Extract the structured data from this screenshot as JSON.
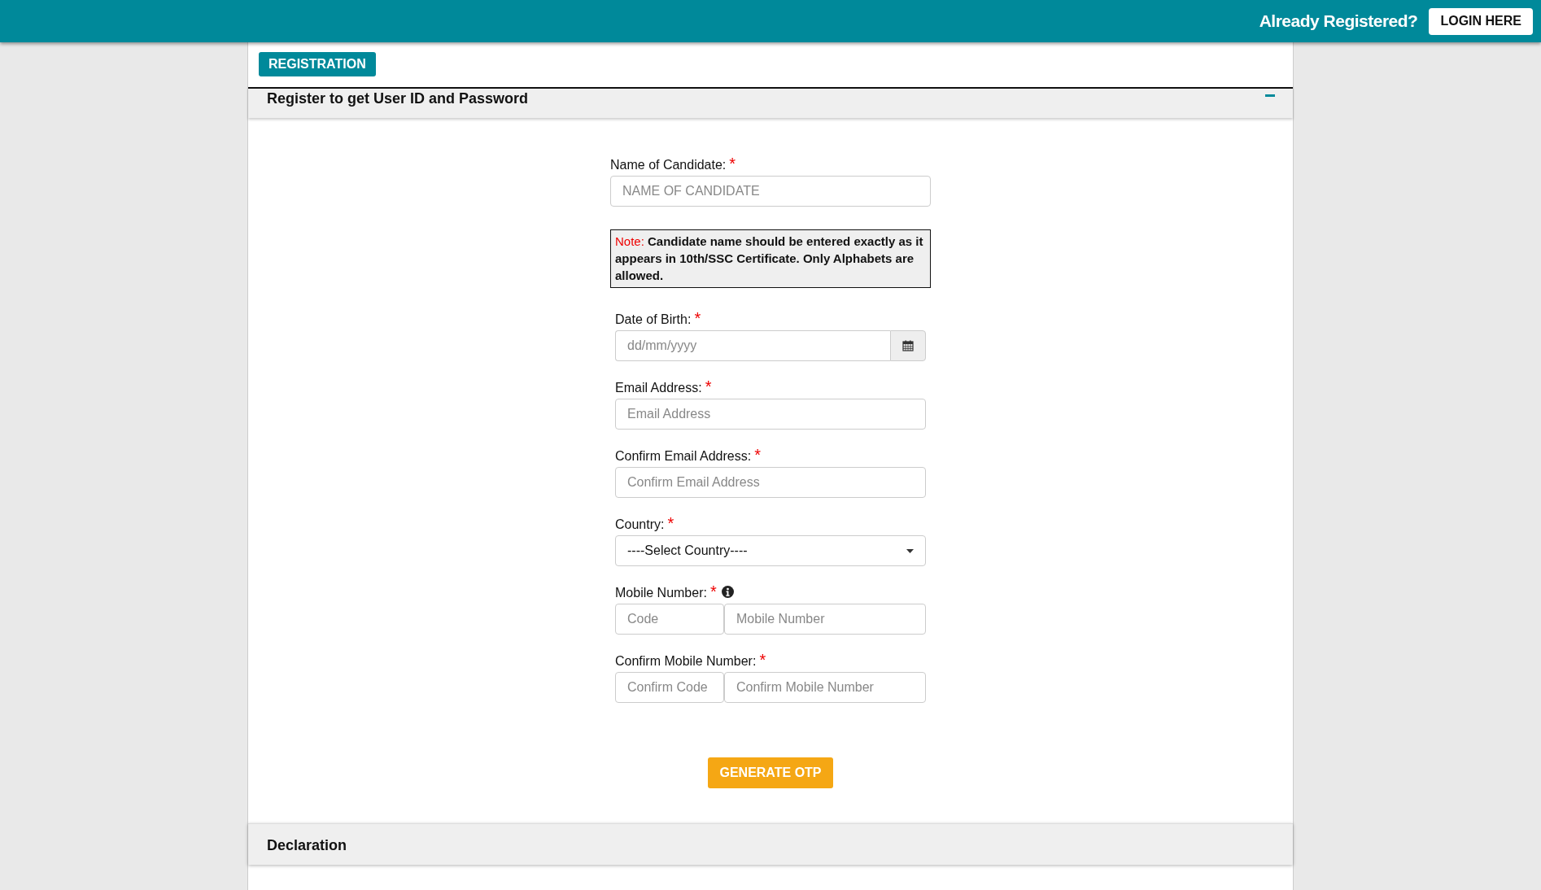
{
  "header": {
    "prompt": "Already Registered?",
    "login_button": "LOGIN HERE"
  },
  "tab": {
    "label": "REGISTRATION",
    "selected": true
  },
  "section": {
    "title": "Register to get User ID and Password",
    "expanded": true
  },
  "fields": [
    {
      "kind": "text",
      "label": "Name of Candidate:",
      "required_mark": "*",
      "placeholder": "NAME OF CANDIDATE"
    },
    {
      "kind": "note",
      "note_label": "Note:",
      "text": "Candidate name should be entered exactly as it appears in 10th/SSC Certificate. Only Alphabets are allowed."
    },
    {
      "kind": "date",
      "label": "Date of Birth:",
      "required_mark": "*",
      "placeholder": "dd/mm/yyyy"
    },
    {
      "kind": "text",
      "label": "Email Address:",
      "required_mark": "*",
      "placeholder": "Email Address"
    },
    {
      "kind": "text",
      "label": "Confirm Email Address:",
      "required_mark": "*",
      "placeholder": "Confirm Email Address"
    },
    {
      "kind": "select",
      "label": "Country:",
      "required_mark": "*",
      "value": "----Select Country----"
    },
    {
      "kind": "pair",
      "label": "Mobile Number:",
      "required_mark": "*",
      "info": true,
      "placeholders": [
        "Code",
        "Mobile Number"
      ]
    },
    {
      "kind": "pair",
      "label": "Confirm Mobile Number:",
      "required_mark": "*",
      "info": false,
      "placeholders": [
        "Confirm Code",
        "Confirm Mobile Number"
      ]
    }
  ],
  "submit_button": "GENERATE OTP",
  "declaration": {
    "title": "Declaration",
    "expanded": false
  }
}
